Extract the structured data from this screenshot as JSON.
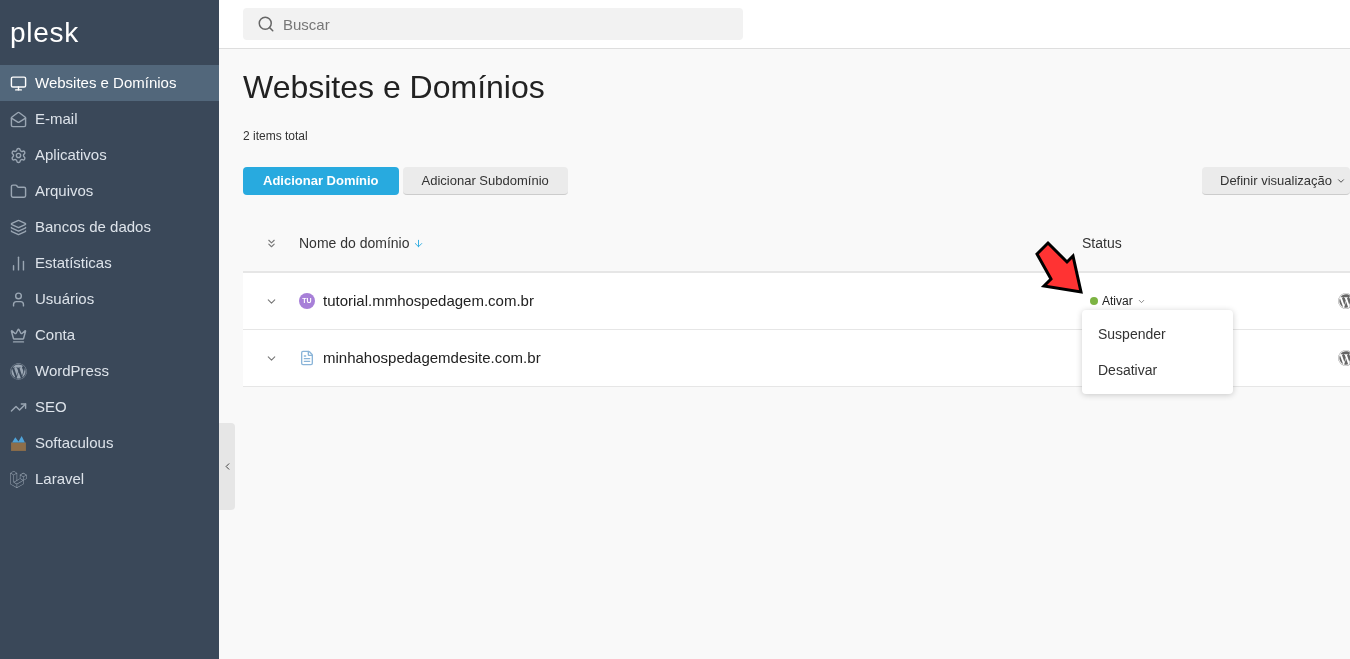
{
  "sidebar": {
    "logo": "plesk",
    "items": [
      {
        "label": "Websites e Domínios",
        "selected": true
      },
      {
        "label": "E-mail",
        "selected": false
      },
      {
        "label": "Aplicativos",
        "selected": false
      },
      {
        "label": "Arquivos",
        "selected": false
      },
      {
        "label": "Bancos de dados",
        "selected": false
      },
      {
        "label": "Estatísticas",
        "selected": false
      },
      {
        "label": "Usuários",
        "selected": false
      },
      {
        "label": "Conta",
        "selected": false
      },
      {
        "label": "WordPress",
        "selected": false
      },
      {
        "label": "SEO",
        "selected": false
      },
      {
        "label": "Softaculous",
        "selected": false
      },
      {
        "label": "Laravel",
        "selected": false
      }
    ]
  },
  "search": {
    "placeholder": "Buscar"
  },
  "page": {
    "title": "Websites e Domínios",
    "count": "2 items total"
  },
  "toolbar": {
    "primary": "Adicionar Domínio",
    "secondary": "Adicionar Subdomínio",
    "view": "Definir visualização"
  },
  "table": {
    "columns": [
      "Nome do domínio",
      "Status"
    ],
    "rows": [
      {
        "kind": "avatar",
        "badge": "TU",
        "name": "tutorial.mmhospedagem.com.br",
        "status": {
          "label": "Ativar",
          "color": "#7cb342"
        }
      },
      {
        "kind": "page",
        "name": "minhahospedagemdesite.com.br"
      }
    ]
  },
  "status_menu": {
    "items": [
      "Suspender",
      "Desativar"
    ]
  }
}
